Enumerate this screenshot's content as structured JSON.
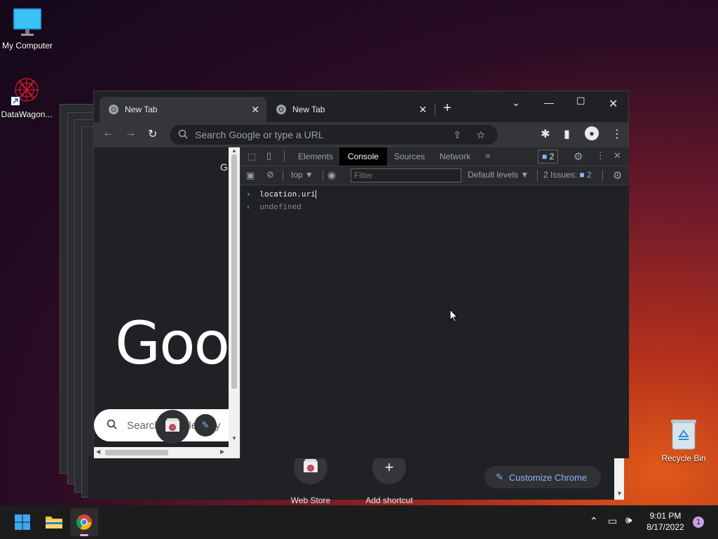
{
  "desktop": {
    "icons": [
      {
        "label": "My Computer"
      },
      {
        "label": "DataWagon..."
      },
      {
        "label": "Recycle Bin"
      }
    ]
  },
  "browser": {
    "tabs": [
      {
        "title": "New Tab",
        "active": true
      },
      {
        "title": "New Tab",
        "active": false
      }
    ],
    "omnibox": {
      "placeholder": "Search Google or type a URL"
    },
    "page": {
      "logo": "Goo",
      "search_placeholder": "Search Google or ty",
      "corner_text": "G"
    },
    "background_page": {
      "shortcuts": [
        {
          "label": "Web Store"
        },
        {
          "label": "Add shortcut"
        }
      ],
      "customize_label": "Customize Chrome"
    }
  },
  "devtools": {
    "tabs": [
      "Elements",
      "Console",
      "Sources",
      "Network"
    ],
    "active_tab": "Console",
    "issues_badge": "2",
    "context": "top",
    "filter_placeholder": "Filter",
    "levels": "Default levels",
    "issues_label": "2 Issues:",
    "issues_count": "2",
    "console": {
      "input": "location.uri",
      "output": "undefined"
    }
  },
  "taskbar": {
    "time": "9:01 PM",
    "date": "8/17/2022",
    "notification_count": "1"
  }
}
